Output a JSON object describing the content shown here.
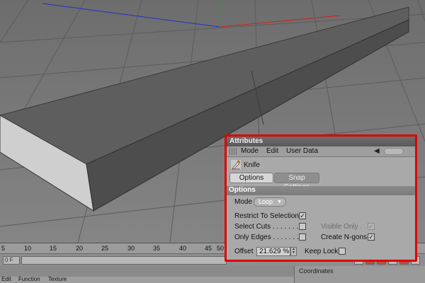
{
  "timeline": {
    "ticks": [
      "5",
      "10",
      "15",
      "20",
      "25",
      "30",
      "35",
      "40",
      "45",
      "50"
    ],
    "start_field": "0 F"
  },
  "material_menu": {
    "items": [
      "Edit",
      "Function",
      "Texture"
    ]
  },
  "coordinates_panel": {
    "title": "Coordinates"
  },
  "attributes": {
    "title": "Attributes",
    "menu": [
      "Mode",
      "Edit",
      "User Data"
    ],
    "tool_name": "Knife",
    "tabs": [
      "Options",
      "Snap Settings"
    ],
    "active_tab": "Options",
    "section_title": "Options",
    "mode": {
      "label": "Mode",
      "value": "Loop"
    },
    "restrict_to_selection": {
      "label": "Restrict To Selection",
      "checked": true
    },
    "select_cuts": {
      "label": "Select Cuts . . . . . . . .",
      "checked": false
    },
    "visible_only": {
      "label": "Visible Only . .",
      "checked": true,
      "disabled": true
    },
    "only_edges": {
      "label": "Only Edges . . . . . . . .",
      "checked": false
    },
    "create_ngons": {
      "label": "Create N-gons",
      "checked": true
    },
    "offset": {
      "label": "Offset",
      "value": "21.629 %"
    },
    "keep_lock": {
      "label": "Keep Lock",
      "checked": false
    }
  },
  "colors": {
    "highlight_frame": "#e00000",
    "panel_bg": "#a9a9a9",
    "viewport_bg": "#7a7a7a",
    "axis_x": "#d02020",
    "axis_y": "#20a020",
    "axis_z": "#2030c0"
  }
}
